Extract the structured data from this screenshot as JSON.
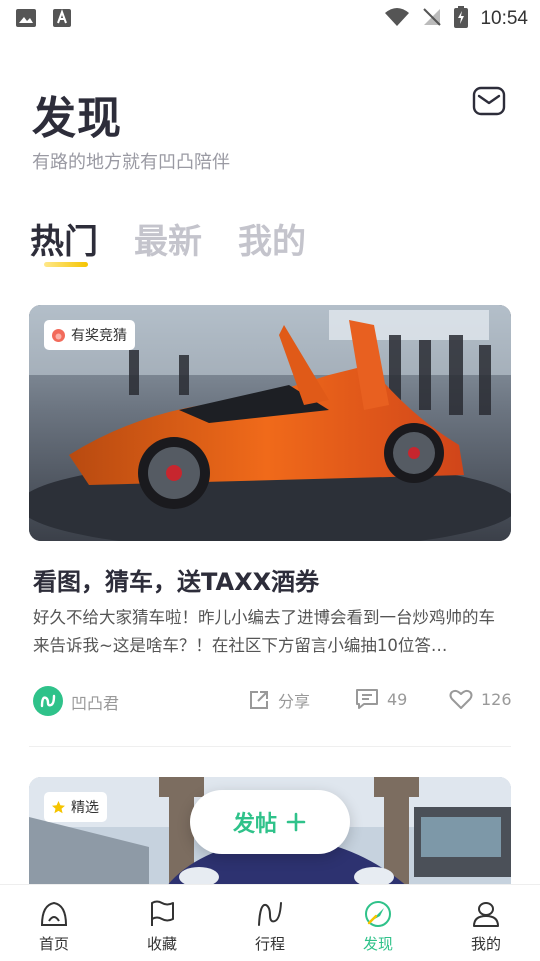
{
  "status_bar": {
    "time": "10:54"
  },
  "header": {
    "title": "发现",
    "subtitle": "有路的地方就有凹凸陪伴"
  },
  "tabs": [
    {
      "label": "热门",
      "active": true
    },
    {
      "label": "最新",
      "active": false
    },
    {
      "label": "我的",
      "active": false
    }
  ],
  "posts": [
    {
      "badge": "有奖竞猜",
      "title": "看图，猜车，送TAXX酒券",
      "description": "好久不给大家猜车啦！昨儿小编去了进博会看到一台炒鸡帅的车来告诉我~这是啥车？！在社区下方留言小编抽10位答…",
      "author": "凹凸君",
      "share_label": "分享",
      "comments": "49",
      "likes": "126"
    },
    {
      "badge": "精选"
    }
  ],
  "post_button": {
    "label": "发帖"
  },
  "bottom_nav": [
    {
      "label": "首页",
      "icon": "home-icon"
    },
    {
      "label": "收藏",
      "icon": "flag-icon"
    },
    {
      "label": "行程",
      "icon": "route-icon"
    },
    {
      "label": "发现",
      "icon": "discover-icon",
      "active": true
    },
    {
      "label": "我的",
      "icon": "profile-icon"
    }
  ],
  "colors": {
    "accent": "#2fc28a",
    "tab_underline": "#f5c400",
    "badge_hot": "#f26b5b",
    "badge_star": "#f5c400"
  }
}
